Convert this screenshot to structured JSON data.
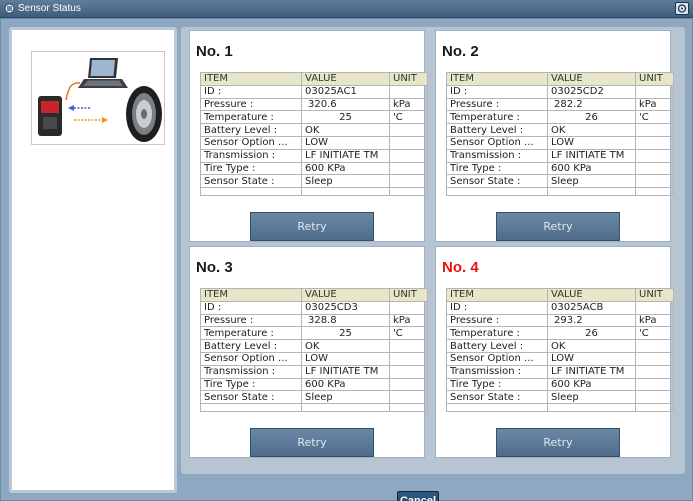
{
  "window": {
    "title": "Sensor Status",
    "title_icon": "app-icon",
    "help_icon": "help-icon"
  },
  "columns": [
    "ITEM",
    "VALUE",
    "UNIT"
  ],
  "labels": {
    "id": "ID :",
    "pressure": "Pressure :",
    "temperature": "Temperature :",
    "battery": "Battery Level :",
    "option": "Sensor Option ...",
    "transmission": "Transmission :",
    "tire_type": "Tire Type :",
    "state": "Sensor State :"
  },
  "sensors": [
    {
      "title": "No. 1",
      "title_color": "#1a1a1a",
      "id": "03025AC1",
      "pressure": "320.6",
      "pressure_unit": "kPa",
      "temperature": "25",
      "temperature_unit": "'C",
      "battery": "OK",
      "option": "LOW",
      "transmission": "LF INITIATE TM",
      "tire_type": "600 KPa",
      "state": "Sleep",
      "button": "Retry"
    },
    {
      "title": "No. 2",
      "title_color": "#1a1a1a",
      "id": "03025CD2",
      "pressure": "282.2",
      "pressure_unit": "kPa",
      "temperature": "26",
      "temperature_unit": "'C",
      "battery": "OK",
      "option": "LOW",
      "transmission": "LF INITIATE TM",
      "tire_type": "600 KPa",
      "state": "Sleep",
      "button": "Retry"
    },
    {
      "title": "No. 3",
      "title_color": "#1a1a1a",
      "id": "03025CD3",
      "pressure": "328.8",
      "pressure_unit": "kPa",
      "temperature": "25",
      "temperature_unit": "'C",
      "battery": "OK",
      "option": "LOW",
      "transmission": "LF INITIATE TM",
      "tire_type": "600 KPa",
      "state": "Sleep",
      "button": "Retry"
    },
    {
      "title": "No. 4",
      "title_color": "#e8130d",
      "id": "03025ACB",
      "pressure": "293.2",
      "pressure_unit": "kPa",
      "temperature": "26",
      "temperature_unit": "'C",
      "battery": "OK",
      "option": "LOW",
      "transmission": "LF INITIATE TM",
      "tire_type": "600 KPa",
      "state": "Sleep",
      "button": "Retry"
    }
  ],
  "footer": {
    "cancel_label": "Cancel"
  },
  "colors": {
    "frame": "#8ea8c1",
    "retry_button": "#5d7b98",
    "cancel_button": "#244a72",
    "alert_title": "#e8130d",
    "table_header": "#e8e6c9"
  }
}
